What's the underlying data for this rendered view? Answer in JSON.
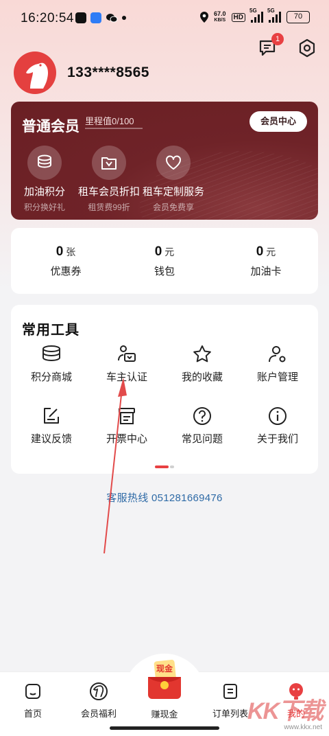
{
  "status_bar": {
    "time": "16:20:54",
    "speed_value": "67.0",
    "speed_unit": "KB/S",
    "hd": "HD",
    "net1": "5G",
    "net2": "5G",
    "battery": "70"
  },
  "header": {
    "message_badge": "1",
    "username": "133****8565"
  },
  "member": {
    "level": "普通会员",
    "mileage": "里程值0/100",
    "center_button": "会员中心",
    "benefits": [
      {
        "title": "加油积分",
        "sub": "积分换好礼"
      },
      {
        "title": "租车会员折扣",
        "sub": "租赁费99折"
      },
      {
        "title": "租车定制服务",
        "sub": "会员免费享"
      }
    ]
  },
  "wallet": [
    {
      "value": "0",
      "unit": "张",
      "label": "优惠券"
    },
    {
      "value": "0",
      "unit": "元",
      "label": "钱包"
    },
    {
      "value": "0",
      "unit": "元",
      "label": "加油卡"
    }
  ],
  "tools": {
    "title": "常用工具",
    "items": [
      {
        "label": "积分商城",
        "icon": "coins-icon"
      },
      {
        "label": "车主认证",
        "icon": "owner-verify-icon"
      },
      {
        "label": "我的收藏",
        "icon": "star-icon"
      },
      {
        "label": "账户管理",
        "icon": "account-settings-icon"
      },
      {
        "label": "建议反馈",
        "icon": "feedback-icon"
      },
      {
        "label": "开票中心",
        "icon": "invoice-icon"
      },
      {
        "label": "常见问题",
        "icon": "question-icon"
      },
      {
        "label": "关于我们",
        "icon": "info-icon"
      }
    ]
  },
  "hotline": "客服热线 051281669476",
  "tabbar": {
    "items": [
      {
        "label": "首页"
      },
      {
        "label": "会员福利"
      },
      {
        "label": "赚现金"
      },
      {
        "label": "订单列表"
      },
      {
        "label": "我的"
      }
    ],
    "cash_badge_text": "现金",
    "active": "我的"
  },
  "watermark": {
    "big": "KK下载",
    "small": "www.kkx.net"
  },
  "colors": {
    "accent": "#e84042",
    "card": "#6f2328",
    "link": "#2e6aa6"
  }
}
